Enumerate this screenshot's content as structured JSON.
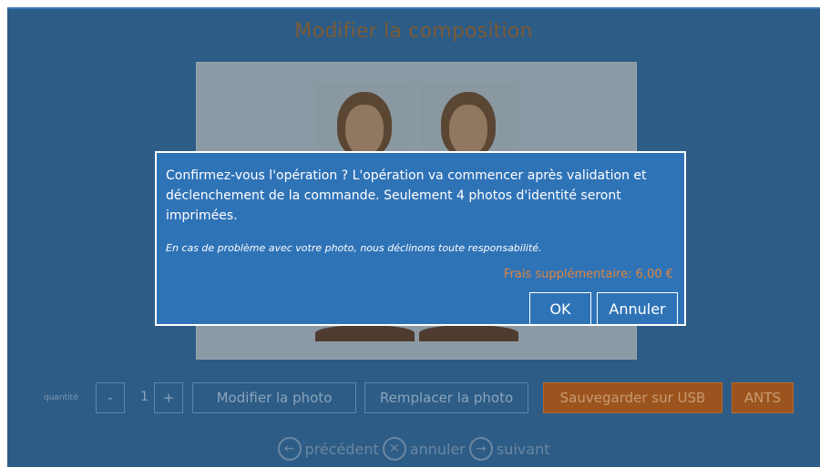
{
  "window": {
    "title": "Modifier la composition"
  },
  "dialog": {
    "message": "Confirmez-vous l'opération ? L'opération va commencer après validation et déclenchement de la commande.  Seulement 4 photos d'identité seront imprimées.",
    "disclaimer": "En cas de problème avec votre photo, nous déclinons toute responsabilité.",
    "fee": "Frais supplémentaire: 6,00 €",
    "ok_label": "OK",
    "cancel_label": "Annuler"
  },
  "toolbar": {
    "quantity_label": "quantité",
    "minus_label": "-",
    "quantity_value": "1",
    "plus_label": "+",
    "edit_photo_label": "Modifier la photo",
    "replace_photo_label": "Remplacer la photo",
    "save_usb_label": "Sauvegarder sur USB",
    "ants_label": "ANTS"
  },
  "nav": {
    "previous_label": "précédent",
    "cancel_label": "annuler",
    "next_label": "suivant",
    "previous_icon": "arrow-left-circle-icon",
    "cancel_icon": "x-circle-icon",
    "next_icon": "arrow-right-circle-icon"
  },
  "colors": {
    "background": "#2d5c86",
    "dialog": "#2f73b7",
    "accent_orange": "#9b541d",
    "fee_text": "#e0863a"
  }
}
